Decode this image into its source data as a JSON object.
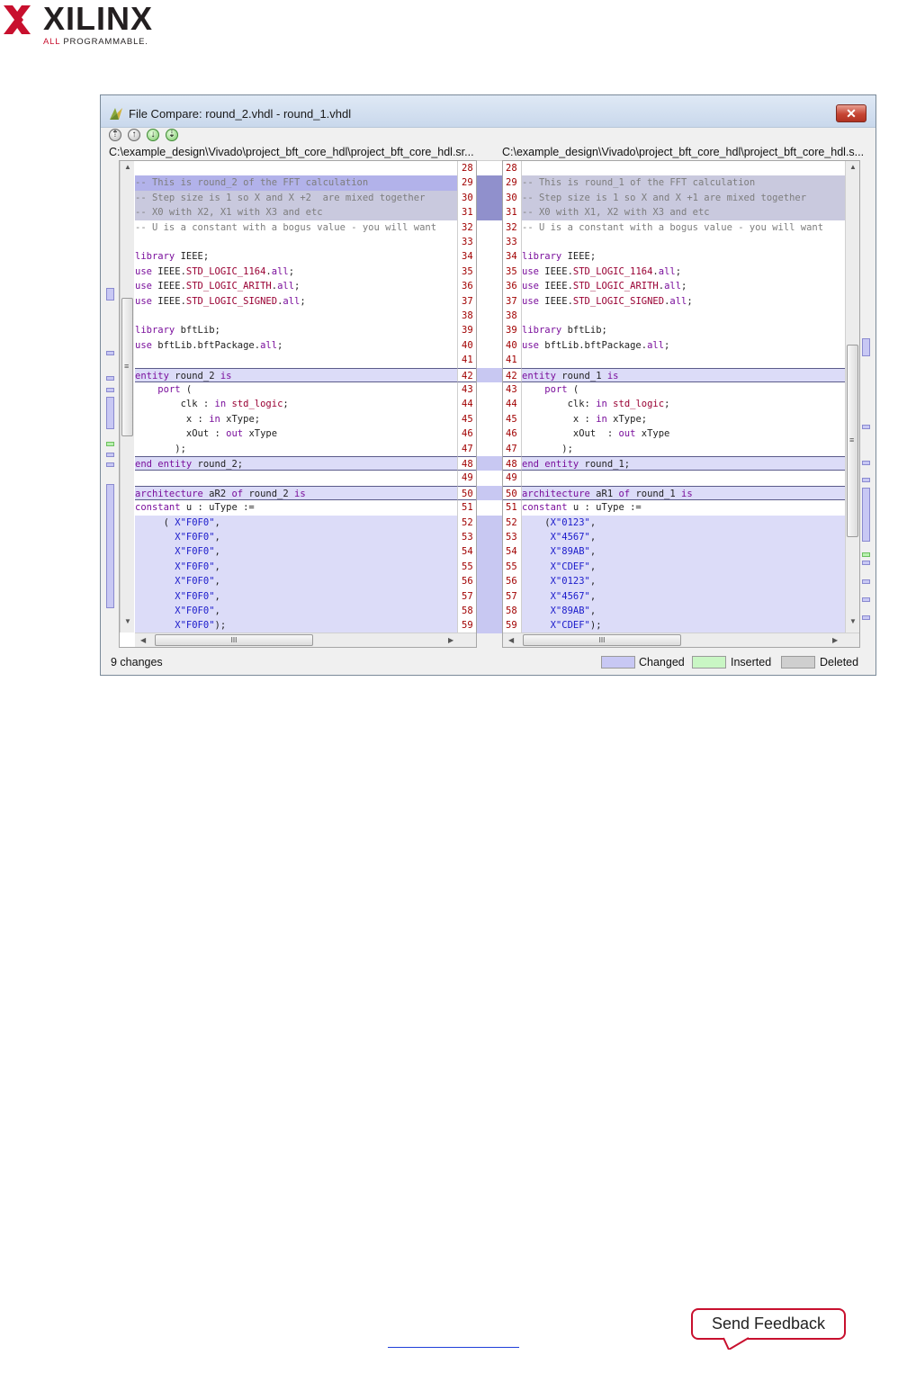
{
  "brand": {
    "name": "XILINX",
    "tagline_prefix": "ALL ",
    "tagline_rest": "PROGRAMMABLE.",
    "red": "#c8102e"
  },
  "window": {
    "title": "File Compare: round_2.vhdl - round_1.vhdl",
    "close_glyph": "✕",
    "toolbar": [
      {
        "name": "first-diff",
        "glyph": "⇡"
      },
      {
        "name": "prev-diff",
        "glyph": "↑"
      },
      {
        "name": "next-diff",
        "glyph": "↓"
      },
      {
        "name": "last-diff",
        "glyph": "⇣"
      }
    ],
    "left_path": "C:\\example_design\\Vivado\\project_bft_core_hdl\\project_bft_core_hdl.sr...",
    "right_path": "C:\\example_design\\Vivado\\project_bft_core_hdl\\project_bft_core_hdl.s...",
    "status": "9 changes",
    "legend": [
      {
        "label": "Changed",
        "color": "#c8c8f4"
      },
      {
        "label": "Inserted",
        "color": "#c9f6c4"
      },
      {
        "label": "Deleted",
        "color": "#cfcfcf"
      }
    ]
  },
  "left_pane": {
    "lines": [
      {
        "n": "28",
        "hl": "",
        "seg": []
      },
      {
        "n": "29",
        "hl": "sel",
        "seg": [
          [
            "cmt",
            "-- This is round_2 of the FFT calculation"
          ]
        ]
      },
      {
        "n": "30",
        "hl": "grey",
        "seg": [
          [
            "cmt",
            "-- Step size is 1 so X and X +2  are mixed together"
          ]
        ]
      },
      {
        "n": "31",
        "hl": "grey",
        "seg": [
          [
            "cmt",
            "-- X0 with X2, X1 with X3 and etc"
          ]
        ]
      },
      {
        "n": "32",
        "hl": "",
        "seg": [
          [
            "cmt",
            "-- U is a constant with a bogus value - you will want"
          ]
        ]
      },
      {
        "n": "33",
        "hl": "",
        "seg": []
      },
      {
        "n": "34",
        "hl": "",
        "seg": [
          [
            "kw",
            "library"
          ],
          [
            "",
            " IEEE;"
          ]
        ]
      },
      {
        "n": "35",
        "hl": "",
        "seg": [
          [
            "kw",
            "use"
          ],
          [
            "",
            " IEEE."
          ],
          [
            "typ",
            "STD_LOGIC_1164"
          ],
          [
            "",
            "."
          ],
          [
            "kw",
            "all"
          ],
          [
            "",
            ";"
          ]
        ]
      },
      {
        "n": "36",
        "hl": "",
        "seg": [
          [
            "kw",
            "use"
          ],
          [
            "",
            " IEEE."
          ],
          [
            "typ",
            "STD_LOGIC_ARITH"
          ],
          [
            "",
            "."
          ],
          [
            "kw",
            "all"
          ],
          [
            "",
            ";"
          ]
        ]
      },
      {
        "n": "37",
        "hl": "",
        "seg": [
          [
            "kw",
            "use"
          ],
          [
            "",
            " IEEE."
          ],
          [
            "typ",
            "STD_LOGIC_SIGNED"
          ],
          [
            "",
            "."
          ],
          [
            "kw",
            "all"
          ],
          [
            "",
            ";"
          ]
        ]
      },
      {
        "n": "38",
        "hl": "",
        "seg": []
      },
      {
        "n": "39",
        "hl": "",
        "seg": [
          [
            "kw",
            "library"
          ],
          [
            "",
            " bftLib;"
          ]
        ]
      },
      {
        "n": "40",
        "hl": "",
        "seg": [
          [
            "kw",
            "use"
          ],
          [
            "",
            " bftLib.bftPackage."
          ],
          [
            "kw",
            "all"
          ],
          [
            "",
            ";"
          ]
        ]
      },
      {
        "n": "41",
        "hl": "",
        "seg": []
      },
      {
        "n": "42",
        "hl": "box",
        "seg": [
          [
            "kw",
            "entity"
          ],
          [
            "",
            " round_2 "
          ],
          [
            "kw",
            "is"
          ]
        ]
      },
      {
        "n": "43",
        "hl": "",
        "seg": [
          [
            "",
            "    "
          ],
          [
            "kw",
            "port"
          ],
          [
            "",
            " ("
          ]
        ]
      },
      {
        "n": "44",
        "hl": "",
        "seg": [
          [
            "",
            "        clk : "
          ],
          [
            "kw",
            "in"
          ],
          [
            "",
            " "
          ],
          [
            "typ",
            "std_logic"
          ],
          [
            "",
            ";"
          ]
        ]
      },
      {
        "n": "45",
        "hl": "",
        "seg": [
          [
            "",
            "         x : "
          ],
          [
            "kw",
            "in"
          ],
          [
            "",
            " xType;"
          ]
        ]
      },
      {
        "n": "46",
        "hl": "",
        "seg": [
          [
            "",
            "         xOut : "
          ],
          [
            "kw",
            "out"
          ],
          [
            "",
            " xType"
          ]
        ]
      },
      {
        "n": "47",
        "hl": "",
        "seg": [
          [
            "",
            "       );"
          ]
        ]
      },
      {
        "n": "48",
        "hl": "box",
        "seg": [
          [
            "kw",
            "end entity"
          ],
          [
            "",
            " round_2;"
          ]
        ]
      },
      {
        "n": "49",
        "hl": "",
        "seg": []
      },
      {
        "n": "50",
        "hl": "box",
        "seg": [
          [
            "kw",
            "architecture"
          ],
          [
            "",
            " aR2 "
          ],
          [
            "kw",
            "of"
          ],
          [
            "",
            " round_2 "
          ],
          [
            "kw",
            "is"
          ]
        ]
      },
      {
        "n": "51",
        "hl": "",
        "seg": [
          [
            "kw",
            "constant"
          ],
          [
            "",
            " u : uType :="
          ]
        ]
      },
      {
        "n": "52",
        "hl": "chg",
        "seg": [
          [
            "",
            "     ( "
          ],
          [
            "str",
            "X\"F0F0\""
          ],
          [
            "",
            ","
          ]
        ]
      },
      {
        "n": "53",
        "hl": "chg",
        "seg": [
          [
            "",
            "       "
          ],
          [
            "str",
            "X\"F0F0\""
          ],
          [
            "",
            ","
          ]
        ]
      },
      {
        "n": "54",
        "hl": "chg",
        "seg": [
          [
            "",
            "       "
          ],
          [
            "str",
            "X\"F0F0\""
          ],
          [
            "",
            ","
          ]
        ]
      },
      {
        "n": "55",
        "hl": "chg",
        "seg": [
          [
            "",
            "       "
          ],
          [
            "str",
            "X\"F0F0\""
          ],
          [
            "",
            ","
          ]
        ]
      },
      {
        "n": "56",
        "hl": "chg",
        "seg": [
          [
            "",
            "       "
          ],
          [
            "str",
            "X\"F0F0\""
          ],
          [
            "",
            ","
          ]
        ]
      },
      {
        "n": "57",
        "hl": "chg",
        "seg": [
          [
            "",
            "       "
          ],
          [
            "str",
            "X\"F0F0\""
          ],
          [
            "",
            ","
          ]
        ]
      },
      {
        "n": "58",
        "hl": "chg",
        "seg": [
          [
            "",
            "       "
          ],
          [
            "str",
            "X\"F0F0\""
          ],
          [
            "",
            ","
          ]
        ]
      },
      {
        "n": "59",
        "hl": "chg",
        "seg": [
          [
            "",
            "       "
          ],
          [
            "str",
            "X\"F0F0\""
          ],
          [
            "",
            ");"
          ]
        ]
      }
    ]
  },
  "right_pane": {
    "lines": [
      {
        "n": "28",
        "hl": "",
        "seg": []
      },
      {
        "n": "29",
        "hl": "grey",
        "seg": [
          [
            "cmt",
            "-- This is round_1 of the FFT calculation"
          ]
        ]
      },
      {
        "n": "30",
        "hl": "grey",
        "seg": [
          [
            "cmt",
            "-- Step size is 1 so X and X +1 are mixed together"
          ]
        ]
      },
      {
        "n": "31",
        "hl": "grey",
        "seg": [
          [
            "cmt",
            "-- X0 with X1, X2 with X3 and etc"
          ]
        ]
      },
      {
        "n": "32",
        "hl": "",
        "seg": [
          [
            "cmt",
            "-- U is a constant with a bogus value - you will want"
          ]
        ]
      },
      {
        "n": "33",
        "hl": "",
        "seg": []
      },
      {
        "n": "34",
        "hl": "",
        "seg": [
          [
            "kw",
            "library"
          ],
          [
            "",
            " IEEE;"
          ]
        ]
      },
      {
        "n": "35",
        "hl": "",
        "seg": [
          [
            "kw",
            "use"
          ],
          [
            "",
            " IEEE."
          ],
          [
            "typ",
            "STD_LOGIC_1164"
          ],
          [
            "",
            "."
          ],
          [
            "kw",
            "all"
          ],
          [
            "",
            ";"
          ]
        ]
      },
      {
        "n": "36",
        "hl": "",
        "seg": [
          [
            "kw",
            "use"
          ],
          [
            "",
            " IEEE."
          ],
          [
            "typ",
            "STD_LOGIC_ARITH"
          ],
          [
            "",
            "."
          ],
          [
            "kw",
            "all"
          ],
          [
            "",
            ";"
          ]
        ]
      },
      {
        "n": "37",
        "hl": "",
        "seg": [
          [
            "kw",
            "use"
          ],
          [
            "",
            " IEEE."
          ],
          [
            "typ",
            "STD_LOGIC_SIGNED"
          ],
          [
            "",
            "."
          ],
          [
            "kw",
            "all"
          ],
          [
            "",
            ";"
          ]
        ]
      },
      {
        "n": "38",
        "hl": "",
        "seg": []
      },
      {
        "n": "39",
        "hl": "",
        "seg": [
          [
            "kw",
            "library"
          ],
          [
            "",
            " bftLib;"
          ]
        ]
      },
      {
        "n": "40",
        "hl": "",
        "seg": [
          [
            "kw",
            "use"
          ],
          [
            "",
            " bftLib.bftPackage."
          ],
          [
            "kw",
            "all"
          ],
          [
            "",
            ";"
          ]
        ]
      },
      {
        "n": "41",
        "hl": "",
        "seg": []
      },
      {
        "n": "42",
        "hl": "box",
        "seg": [
          [
            "kw",
            "entity"
          ],
          [
            "",
            " round_1 "
          ],
          [
            "kw",
            "is"
          ]
        ]
      },
      {
        "n": "43",
        "hl": "",
        "seg": [
          [
            "",
            "    "
          ],
          [
            "kw",
            "port"
          ],
          [
            "",
            " ("
          ]
        ]
      },
      {
        "n": "44",
        "hl": "",
        "seg": [
          [
            "",
            "        clk: "
          ],
          [
            "kw",
            "in"
          ],
          [
            "",
            " "
          ],
          [
            "typ",
            "std_logic"
          ],
          [
            "",
            ";"
          ]
        ]
      },
      {
        "n": "45",
        "hl": "",
        "seg": [
          [
            "",
            "         x : "
          ],
          [
            "kw",
            "in"
          ],
          [
            "",
            " xType;"
          ]
        ]
      },
      {
        "n": "46",
        "hl": "",
        "seg": [
          [
            "",
            "         xOut  : "
          ],
          [
            "kw",
            "out"
          ],
          [
            "",
            " xType"
          ]
        ]
      },
      {
        "n": "47",
        "hl": "",
        "seg": [
          [
            "",
            "       );"
          ]
        ]
      },
      {
        "n": "48",
        "hl": "box",
        "seg": [
          [
            "kw",
            "end entity"
          ],
          [
            "",
            " round_1;"
          ]
        ]
      },
      {
        "n": "49",
        "hl": "",
        "seg": []
      },
      {
        "n": "50",
        "hl": "box",
        "seg": [
          [
            "kw",
            "architecture"
          ],
          [
            "",
            " aR1 "
          ],
          [
            "kw",
            "of"
          ],
          [
            "",
            " round_1 "
          ],
          [
            "kw",
            "is"
          ]
        ]
      },
      {
        "n": "51",
        "hl": "",
        "seg": [
          [
            "kw",
            "constant"
          ],
          [
            "",
            " u : uType :="
          ]
        ]
      },
      {
        "n": "52",
        "hl": "chg",
        "seg": [
          [
            "",
            "    ("
          ],
          [
            "str",
            "X\"0123\""
          ],
          [
            "",
            ","
          ]
        ]
      },
      {
        "n": "53",
        "hl": "chg",
        "seg": [
          [
            "",
            "     "
          ],
          [
            "str",
            "X\"4567\""
          ],
          [
            "",
            ","
          ]
        ]
      },
      {
        "n": "54",
        "hl": "chg",
        "seg": [
          [
            "",
            "     "
          ],
          [
            "str",
            "X\"89AB\""
          ],
          [
            "",
            ","
          ]
        ]
      },
      {
        "n": "55",
        "hl": "chg",
        "seg": [
          [
            "",
            "     "
          ],
          [
            "str",
            "X\"CDEF\""
          ],
          [
            "",
            ","
          ]
        ]
      },
      {
        "n": "56",
        "hl": "chg",
        "seg": [
          [
            "",
            "     "
          ],
          [
            "str",
            "X\"0123\""
          ],
          [
            "",
            ","
          ]
        ]
      },
      {
        "n": "57",
        "hl": "chg",
        "seg": [
          [
            "",
            "     "
          ],
          [
            "str",
            "X\"4567\""
          ],
          [
            "",
            ","
          ]
        ]
      },
      {
        "n": "58",
        "hl": "chg",
        "seg": [
          [
            "",
            "     "
          ],
          [
            "str",
            "X\"89AB\""
          ],
          [
            "",
            ","
          ]
        ]
      },
      {
        "n": "59",
        "hl": "chg",
        "seg": [
          [
            "",
            "     "
          ],
          [
            "str",
            "X\"CDEF\""
          ],
          [
            "",
            ");"
          ]
        ]
      }
    ]
  },
  "scroll": {
    "h_thumb_glyph": "III",
    "v_thumb_glyph": "≡",
    "up": "▲",
    "down": "▼",
    "left": "◀",
    "right": "▶"
  },
  "footer": {
    "feedback": "Send Feedback"
  }
}
